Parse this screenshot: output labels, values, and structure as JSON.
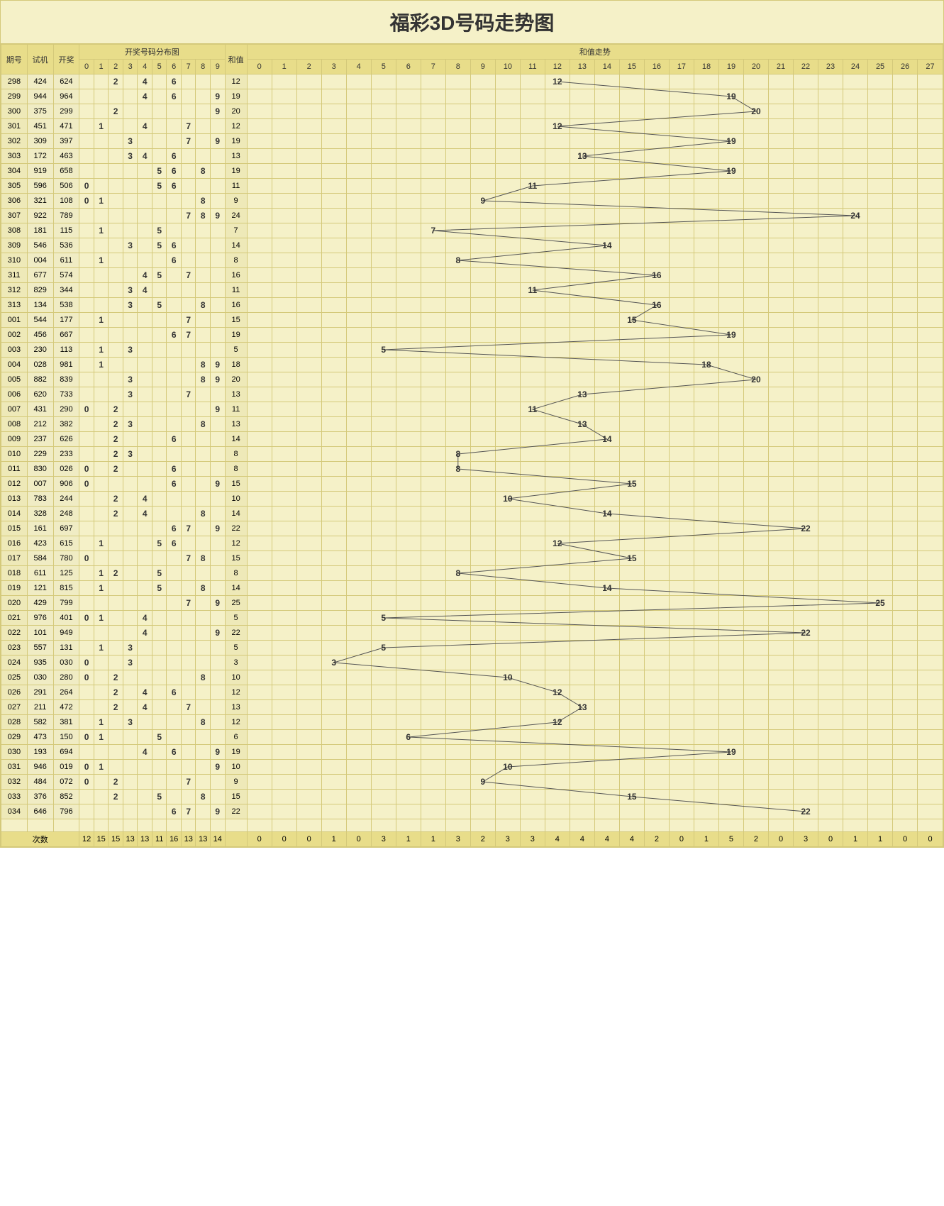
{
  "title": "福彩3D号码走势图",
  "headers": {
    "period": "期号",
    "test": "试机",
    "draw": "开奖",
    "dist": "开奖号码分布图",
    "sum": "和值",
    "trend": "和值走势",
    "nums": [
      "0",
      "1",
      "2",
      "3",
      "4",
      "5",
      "6",
      "7",
      "8",
      "9"
    ],
    "trend_cols": [
      "0",
      "1",
      "2",
      "3",
      "4",
      "5",
      "6",
      "7",
      "8",
      "9",
      "10",
      "11",
      "12",
      "13",
      "14",
      "15",
      "16",
      "17",
      "18",
      "19",
      "20",
      "21",
      "22",
      "23",
      "24",
      "25",
      "26",
      "27"
    ]
  },
  "footer_label": "次数",
  "chart_data": {
    "type": "table+line",
    "rows": [
      {
        "period": "298",
        "test": "424",
        "draw": "624",
        "nums": [
          2,
          4,
          6
        ],
        "sum": 12
      },
      {
        "period": "299",
        "test": "944",
        "draw": "964",
        "nums": [
          4,
          6,
          9
        ],
        "sum": 19
      },
      {
        "period": "300",
        "test": "375",
        "draw": "299",
        "nums": [
          2,
          9
        ],
        "sum": 20
      },
      {
        "period": "301",
        "test": "451",
        "draw": "471",
        "nums": [
          1,
          4,
          7
        ],
        "sum": 12
      },
      {
        "period": "302",
        "test": "309",
        "draw": "397",
        "nums": [
          3,
          7,
          9
        ],
        "sum": 19
      },
      {
        "period": "303",
        "test": "172",
        "draw": "463",
        "nums": [
          3,
          4,
          6
        ],
        "sum": 13
      },
      {
        "period": "304",
        "test": "919",
        "draw": "658",
        "nums": [
          5,
          6,
          8
        ],
        "sum": 19
      },
      {
        "period": "305",
        "test": "596",
        "draw": "506",
        "nums": [
          0,
          5,
          6
        ],
        "sum": 11
      },
      {
        "period": "306",
        "test": "321",
        "draw": "108",
        "nums": [
          0,
          1,
          8
        ],
        "sum": 9
      },
      {
        "period": "307",
        "test": "922",
        "draw": "789",
        "nums": [
          7,
          8,
          9
        ],
        "sum": 24
      },
      {
        "period": "308",
        "test": "181",
        "draw": "115",
        "nums": [
          1,
          5
        ],
        "sum": 7
      },
      {
        "period": "309",
        "test": "546",
        "draw": "536",
        "nums": [
          3,
          5,
          6
        ],
        "sum": 14
      },
      {
        "period": "310",
        "test": "004",
        "draw": "611",
        "nums": [
          1,
          6
        ],
        "sum": 8
      },
      {
        "period": "311",
        "test": "677",
        "draw": "574",
        "nums": [
          4,
          5,
          7
        ],
        "sum": 16
      },
      {
        "period": "312",
        "test": "829",
        "draw": "344",
        "nums": [
          3,
          4
        ],
        "sum": 11
      },
      {
        "period": "313",
        "test": "134",
        "draw": "538",
        "nums": [
          3,
          5,
          8
        ],
        "sum": 16
      },
      {
        "period": "001",
        "test": "544",
        "draw": "177",
        "nums": [
          1,
          7
        ],
        "sum": 15
      },
      {
        "period": "002",
        "test": "456",
        "draw": "667",
        "nums": [
          6,
          7
        ],
        "sum": 19
      },
      {
        "period": "003",
        "test": "230",
        "draw": "113",
        "nums": [
          1,
          3
        ],
        "sum": 5
      },
      {
        "period": "004",
        "test": "028",
        "draw": "981",
        "nums": [
          1,
          8,
          9
        ],
        "sum": 18
      },
      {
        "period": "005",
        "test": "882",
        "draw": "839",
        "nums": [
          3,
          8,
          9
        ],
        "sum": 20
      },
      {
        "period": "006",
        "test": "620",
        "draw": "733",
        "nums": [
          3,
          7
        ],
        "sum": 13
      },
      {
        "period": "007",
        "test": "431",
        "draw": "290",
        "nums": [
          0,
          2,
          9
        ],
        "sum": 11
      },
      {
        "period": "008",
        "test": "212",
        "draw": "382",
        "nums": [
          2,
          3,
          8
        ],
        "sum": 13
      },
      {
        "period": "009",
        "test": "237",
        "draw": "626",
        "nums": [
          2,
          6
        ],
        "sum": 14
      },
      {
        "period": "010",
        "test": "229",
        "draw": "233",
        "nums": [
          2,
          3
        ],
        "sum": 8
      },
      {
        "period": "011",
        "test": "830",
        "draw": "026",
        "nums": [
          0,
          2,
          6
        ],
        "sum": 8
      },
      {
        "period": "012",
        "test": "007",
        "draw": "906",
        "nums": [
          0,
          6,
          9
        ],
        "sum": 15
      },
      {
        "period": "013",
        "test": "783",
        "draw": "244",
        "nums": [
          2,
          4
        ],
        "sum": 10
      },
      {
        "period": "014",
        "test": "328",
        "draw": "248",
        "nums": [
          2,
          4,
          8
        ],
        "sum": 14
      },
      {
        "period": "015",
        "test": "161",
        "draw": "697",
        "nums": [
          6,
          7,
          9
        ],
        "sum": 22
      },
      {
        "period": "016",
        "test": "423",
        "draw": "615",
        "nums": [
          1,
          5,
          6
        ],
        "sum": 12
      },
      {
        "period": "017",
        "test": "584",
        "draw": "780",
        "nums": [
          0,
          7,
          8
        ],
        "sum": 15
      },
      {
        "period": "018",
        "test": "611",
        "draw": "125",
        "nums": [
          1,
          2,
          5
        ],
        "sum": 8
      },
      {
        "period": "019",
        "test": "121",
        "draw": "815",
        "nums": [
          1,
          5,
          8
        ],
        "sum": 14
      },
      {
        "period": "020",
        "test": "429",
        "draw": "799",
        "nums": [
          7,
          9
        ],
        "sum": 25
      },
      {
        "period": "021",
        "test": "976",
        "draw": "401",
        "nums": [
          0,
          1,
          4
        ],
        "sum": 5
      },
      {
        "period": "022",
        "test": "101",
        "draw": "949",
        "nums": [
          4,
          9
        ],
        "sum": 22
      },
      {
        "period": "023",
        "test": "557",
        "draw": "131",
        "nums": [
          1,
          3
        ],
        "sum": 5
      },
      {
        "period": "024",
        "test": "935",
        "draw": "030",
        "nums": [
          0,
          3
        ],
        "sum": 3
      },
      {
        "period": "025",
        "test": "030",
        "draw": "280",
        "nums": [
          0,
          2,
          8
        ],
        "sum": 10
      },
      {
        "period": "026",
        "test": "291",
        "draw": "264",
        "nums": [
          2,
          4,
          6
        ],
        "sum": 12
      },
      {
        "period": "027",
        "test": "211",
        "draw": "472",
        "nums": [
          2,
          4,
          7
        ],
        "sum": 13
      },
      {
        "period": "028",
        "test": "582",
        "draw": "381",
        "nums": [
          1,
          3,
          8
        ],
        "sum": 12
      },
      {
        "period": "029",
        "test": "473",
        "draw": "150",
        "nums": [
          0,
          1,
          5
        ],
        "sum": 6
      },
      {
        "period": "030",
        "test": "193",
        "draw": "694",
        "nums": [
          4,
          6,
          9
        ],
        "sum": 19
      },
      {
        "period": "031",
        "test": "946",
        "draw": "019",
        "nums": [
          0,
          1,
          9
        ],
        "sum": 10
      },
      {
        "period": "032",
        "test": "484",
        "draw": "072",
        "nums": [
          0,
          2,
          7
        ],
        "sum": 9
      },
      {
        "period": "033",
        "test": "376",
        "draw": "852",
        "nums": [
          2,
          5,
          8
        ],
        "sum": 15
      },
      {
        "period": "034",
        "test": "646",
        "draw": "796",
        "nums": [
          6,
          7,
          9
        ],
        "sum": 22
      }
    ],
    "num_counts": [
      12,
      15,
      15,
      13,
      13,
      11,
      16,
      13,
      13,
      14
    ],
    "trend_counts": [
      0,
      0,
      0,
      1,
      0,
      3,
      1,
      1,
      3,
      2,
      3,
      3,
      4,
      4,
      4,
      4,
      2,
      0,
      1,
      5,
      2,
      0,
      3,
      0,
      1,
      1,
      0,
      0
    ]
  }
}
